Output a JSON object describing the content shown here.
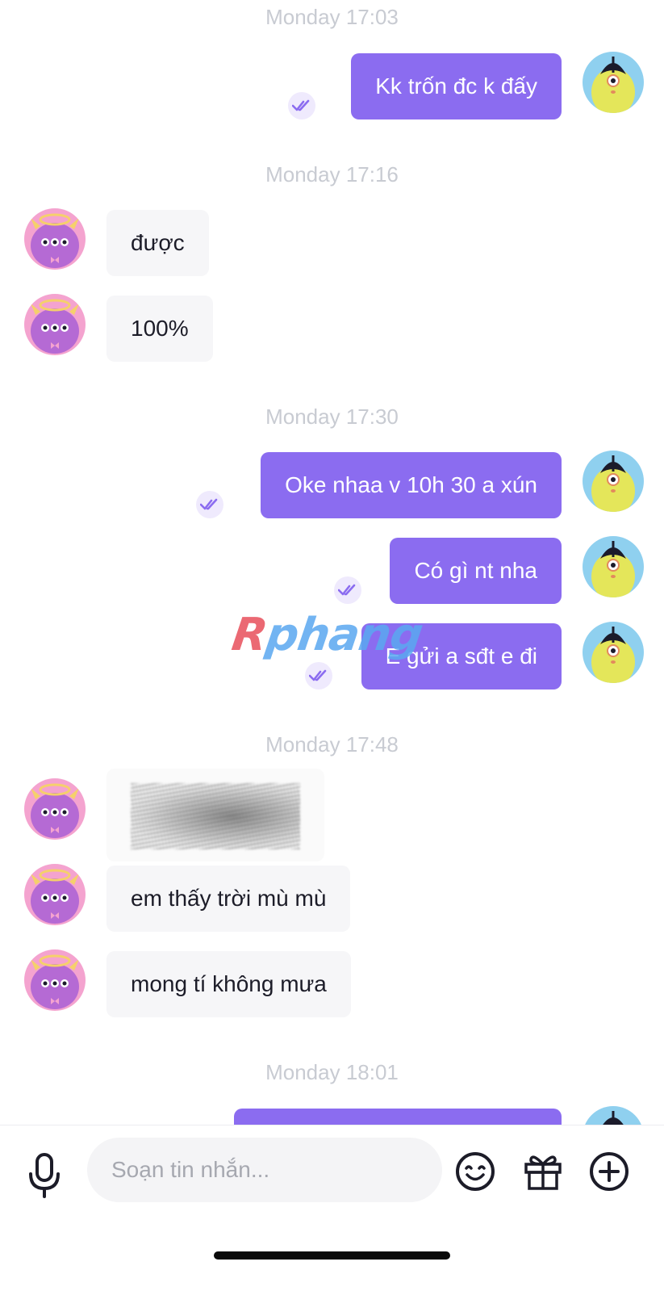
{
  "messages": [
    {
      "type": "timestamp",
      "text": "Monday 17:03"
    },
    {
      "type": "out",
      "text": "Kk trốn đc k đấy",
      "status": "read"
    },
    {
      "type": "timestamp",
      "text": "Monday 17:16"
    },
    {
      "type": "in",
      "text": "được"
    },
    {
      "type": "in",
      "text": "100%"
    },
    {
      "type": "timestamp",
      "text": "Monday 17:30"
    },
    {
      "type": "out",
      "text": "Oke nhaa v 10h 30 a xún",
      "status": "read"
    },
    {
      "type": "out",
      "text": "Có gì nt nha",
      "status": "read"
    },
    {
      "type": "out",
      "text": "E gửi a sđt e đi",
      "status": "read"
    },
    {
      "type": "timestamp",
      "text": "Monday 17:48"
    },
    {
      "type": "in",
      "content": "redacted-scribble"
    },
    {
      "type": "in",
      "text": "em thấy trời mù mù"
    },
    {
      "type": "in",
      "text": "mong tí không mưa"
    },
    {
      "type": "timestamp",
      "text": "Monday 18:01"
    },
    {
      "type": "out",
      "text": "",
      "status": "partially-visible"
    }
  ],
  "watermark": {
    "first_letter": "R",
    "rest": "phang"
  },
  "composer": {
    "placeholder": "Soạn tin nhắn...",
    "icons": [
      "microphone-icon",
      "emoji-icon",
      "gift-icon",
      "plus-circle-icon"
    ]
  },
  "colors": {
    "outgoing_bubble": "#8b6cf0",
    "incoming_bubble": "#f6f6f8",
    "timestamp": "#c8cbd2",
    "read_tick": "#8b6cf0"
  }
}
